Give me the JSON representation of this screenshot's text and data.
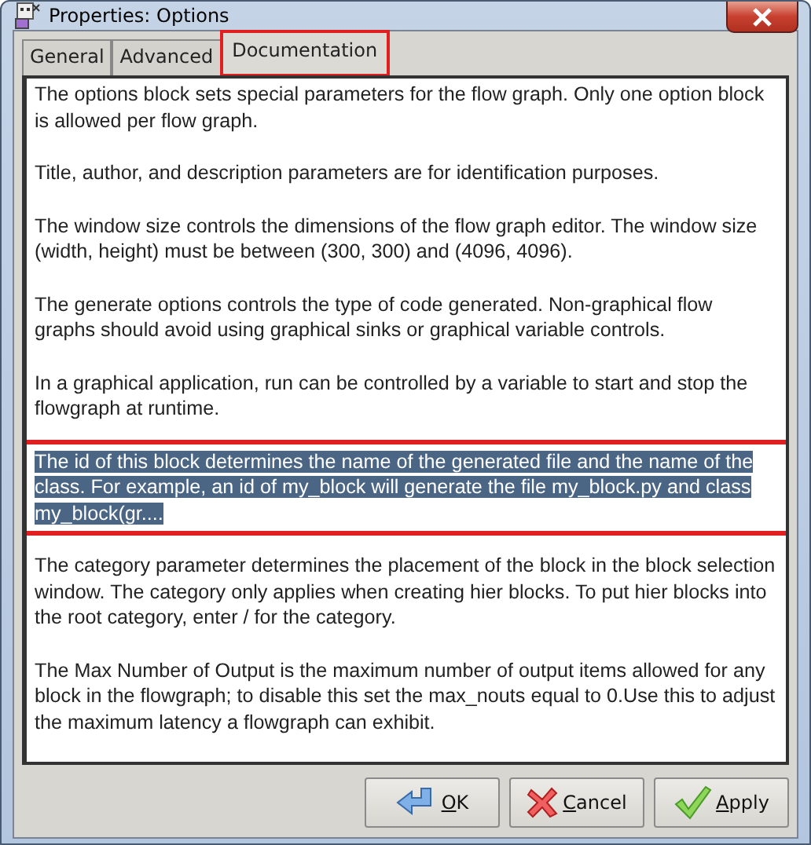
{
  "window": {
    "title": "Properties: Options"
  },
  "tabs": [
    {
      "label": "General",
      "selected": false,
      "highlighted": false
    },
    {
      "label": "Advanced",
      "selected": false,
      "highlighted": false
    },
    {
      "label": "Documentation",
      "selected": true,
      "highlighted": true
    }
  ],
  "documentation": [
    {
      "text": "The options block sets special parameters for the flow graph. Only one option block is allowed per flow graph.",
      "selected": false,
      "highlighted": false
    },
    {
      "text": "Title, author, and description parameters are for identification purposes.",
      "selected": false,
      "highlighted": false
    },
    {
      "text": "The window size controls the dimensions of the flow graph editor. The window size (width, height) must be between (300, 300) and (4096, 4096).",
      "selected": false,
      "highlighted": false
    },
    {
      "text": "The generate options controls the type of code generated. Non-graphical flow graphs should avoid using graphical sinks or graphical variable controls.",
      "selected": false,
      "highlighted": false
    },
    {
      "text": "In a graphical application, run can be controlled by a variable to start and stop the flowgraph at runtime.",
      "selected": false,
      "highlighted": false
    },
    {
      "text": "The id of this block determines the name of the generated file and the name of the class. For example, an id of my_block will generate the file my_block.py and class my_block(gr....",
      "selected": true,
      "highlighted": true
    },
    {
      "text": "The category parameter determines the placement of the block in the block selection window. The category only applies when creating hier blocks. To put hier blocks into the root category, enter / for the category.",
      "selected": false,
      "highlighted": false
    },
    {
      "text": "The Max Number of Output is the maximum number of output items allowed for any block in the flowgraph; to disable this set the max_nouts equal to 0.Use this to adjust the maximum latency a flowgraph can exhibit.",
      "selected": false,
      "highlighted": false
    }
  ],
  "buttons": [
    {
      "label": "OK",
      "kind": "ok"
    },
    {
      "label": "Cancel",
      "kind": "cancel"
    },
    {
      "label": "Apply",
      "kind": "apply"
    }
  ]
}
